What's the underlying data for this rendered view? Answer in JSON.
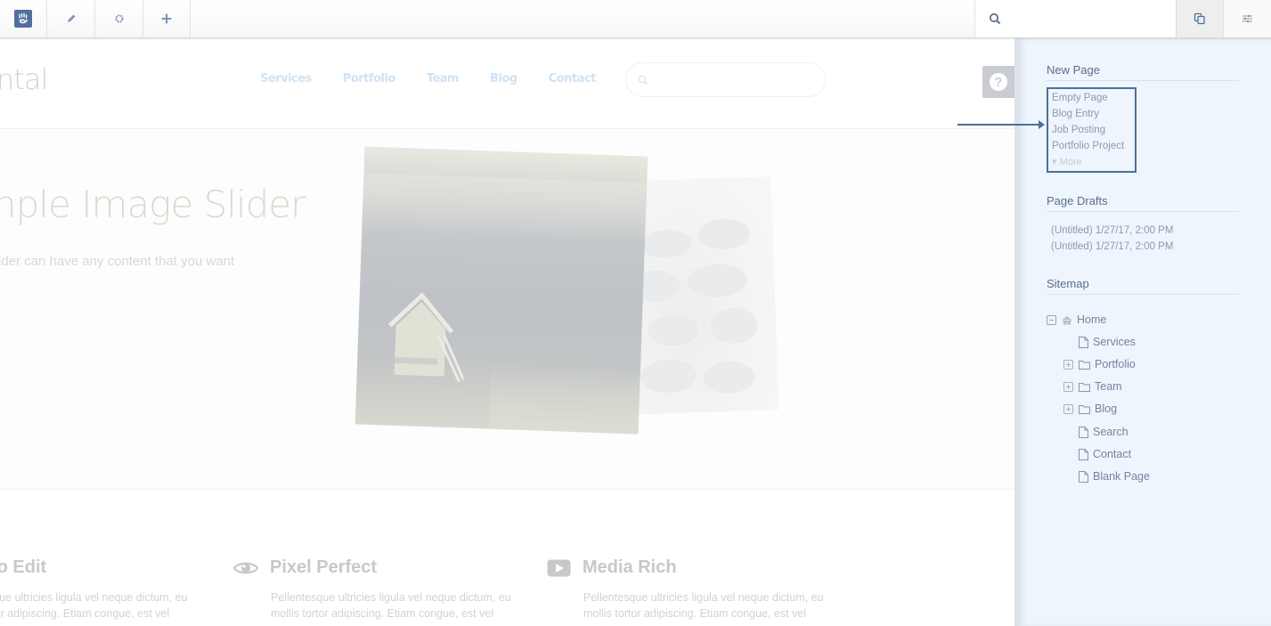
{
  "toolbar": {
    "buttons": [
      {
        "name": "concrete-logo",
        "icon": "hand-logo-icon"
      },
      {
        "name": "edit",
        "icon": "pencil-icon"
      },
      {
        "name": "settings",
        "icon": "gear-icon"
      },
      {
        "name": "add",
        "icon": "plus-move-icon"
      }
    ],
    "search_placeholder": "",
    "right_buttons": [
      {
        "name": "sitemap",
        "icon": "pages-icon",
        "active": true
      },
      {
        "name": "dashboard",
        "icon": "sliders-icon",
        "active": false
      }
    ],
    "accent_color": "#4f6f9e"
  },
  "site": {
    "logo_text": "ntal",
    "nav": [
      "Services",
      "Portfolio",
      "Team",
      "Blog",
      "Contact"
    ],
    "search_placeholder": "",
    "help_label": "?",
    "hero": {
      "title": "nple Image Slider",
      "subtitle": "ider can have any content that you want"
    },
    "features": [
      {
        "icon": "",
        "title": "to Edit",
        "text_line1": "sque ultricies ligula vel neque dictum, eu",
        "text_line2": "rtor adipiscing. Etiam congue, est vel"
      },
      {
        "icon": "eye-icon",
        "title": "Pixel Perfect",
        "text_line1": "Pellentesque ultricies ligula vel neque dictum, eu",
        "text_line2": "mollis tortor adipiscing. Etiam congue, est vel"
      },
      {
        "icon": "play-icon",
        "title": "Media Rich",
        "text_line1": "Pellentesque ultricies ligula vel neque dictum, eu",
        "text_line2": "mollis tortor adipiscing. Etiam congue, est vel"
      }
    ]
  },
  "sidebar": {
    "new_page": {
      "heading": "New Page",
      "items": [
        "Empty Page",
        "Blog Entry",
        "Job Posting",
        "Portfolio Project"
      ],
      "more_label": "More",
      "highlight_color": "#4d6f9c"
    },
    "drafts": {
      "heading": "Page Drafts",
      "items": [
        "(Untitled) 1/27/17, 2:00 PM",
        "(Untitled) 1/27/17, 2:00 PM"
      ]
    },
    "sitemap": {
      "heading": "Sitemap",
      "tree": [
        {
          "label": "Home",
          "type": "home",
          "toggle": "collapse",
          "level": 0
        },
        {
          "label": "Services",
          "type": "page",
          "toggle": null,
          "level": 1
        },
        {
          "label": "Portfolio",
          "type": "folder",
          "toggle": "expand",
          "level": 1
        },
        {
          "label": "Team",
          "type": "folder",
          "toggle": "expand",
          "level": 1
        },
        {
          "label": "Blog",
          "type": "folder",
          "toggle": "expand",
          "level": 1
        },
        {
          "label": "Search",
          "type": "page",
          "toggle": null,
          "level": 1
        },
        {
          "label": "Contact",
          "type": "page",
          "toggle": null,
          "level": 1
        },
        {
          "label": "Blank Page",
          "type": "page",
          "toggle": null,
          "level": 1
        }
      ]
    }
  }
}
